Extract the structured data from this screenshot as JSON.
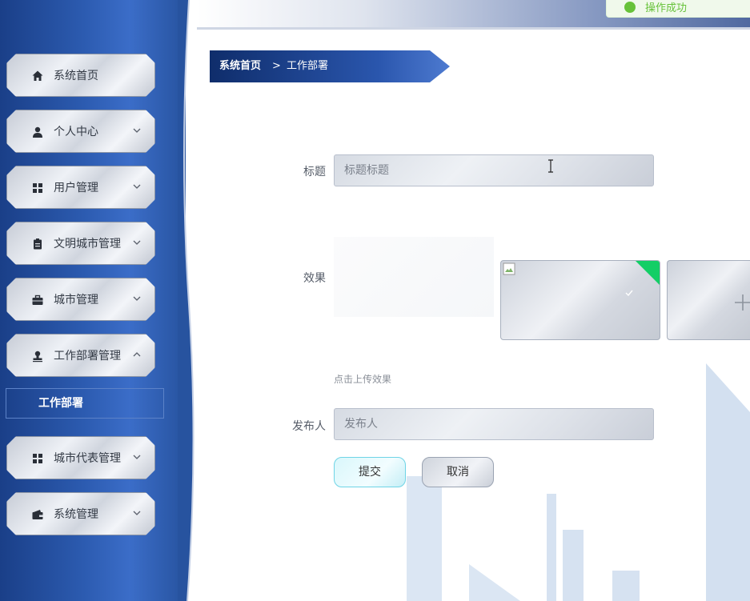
{
  "toast": {
    "text": "操作成功"
  },
  "breadcrumb": {
    "home": "系统首页",
    "separator": ">",
    "current": "工作部署"
  },
  "sidebar": {
    "items": [
      {
        "label": "系统首页",
        "icon": "home-icon",
        "has_chevron": false
      },
      {
        "label": "个人中心",
        "icon": "user-icon",
        "has_chevron": true,
        "expanded": false
      },
      {
        "label": "用户管理",
        "icon": "grid-icon",
        "has_chevron": true,
        "expanded": false
      },
      {
        "label": "文明城市管理",
        "icon": "clipboard-icon",
        "has_chevron": true,
        "expanded": false
      },
      {
        "label": "城市管理",
        "icon": "briefcase-icon",
        "has_chevron": true,
        "expanded": false
      },
      {
        "label": "工作部署管理",
        "icon": "stamp-icon",
        "has_chevron": true,
        "expanded": true
      },
      {
        "label": "城市代表管理",
        "icon": "grid-icon",
        "has_chevron": true,
        "expanded": false
      },
      {
        "label": "系统管理",
        "icon": "wallet-icon",
        "has_chevron": true,
        "expanded": false
      }
    ],
    "submenu": [
      {
        "label": "工作部署",
        "active": true
      }
    ]
  },
  "form": {
    "title_label": "标题",
    "title_placeholder": "标题标题",
    "effect_label": "效果",
    "upload_hint": "点击上传效果",
    "publisher_label": "发布人",
    "publisher_placeholder": "发布人",
    "submit_label": "提交",
    "cancel_label": "取消"
  },
  "colors": {
    "sidebar_blue": "#2c5bb0",
    "breadcrumb_blue": "#1a3f88",
    "success_green": "#67c23a",
    "upload_badge_green": "#13ce66",
    "submit_border": "#6fd4e6"
  }
}
